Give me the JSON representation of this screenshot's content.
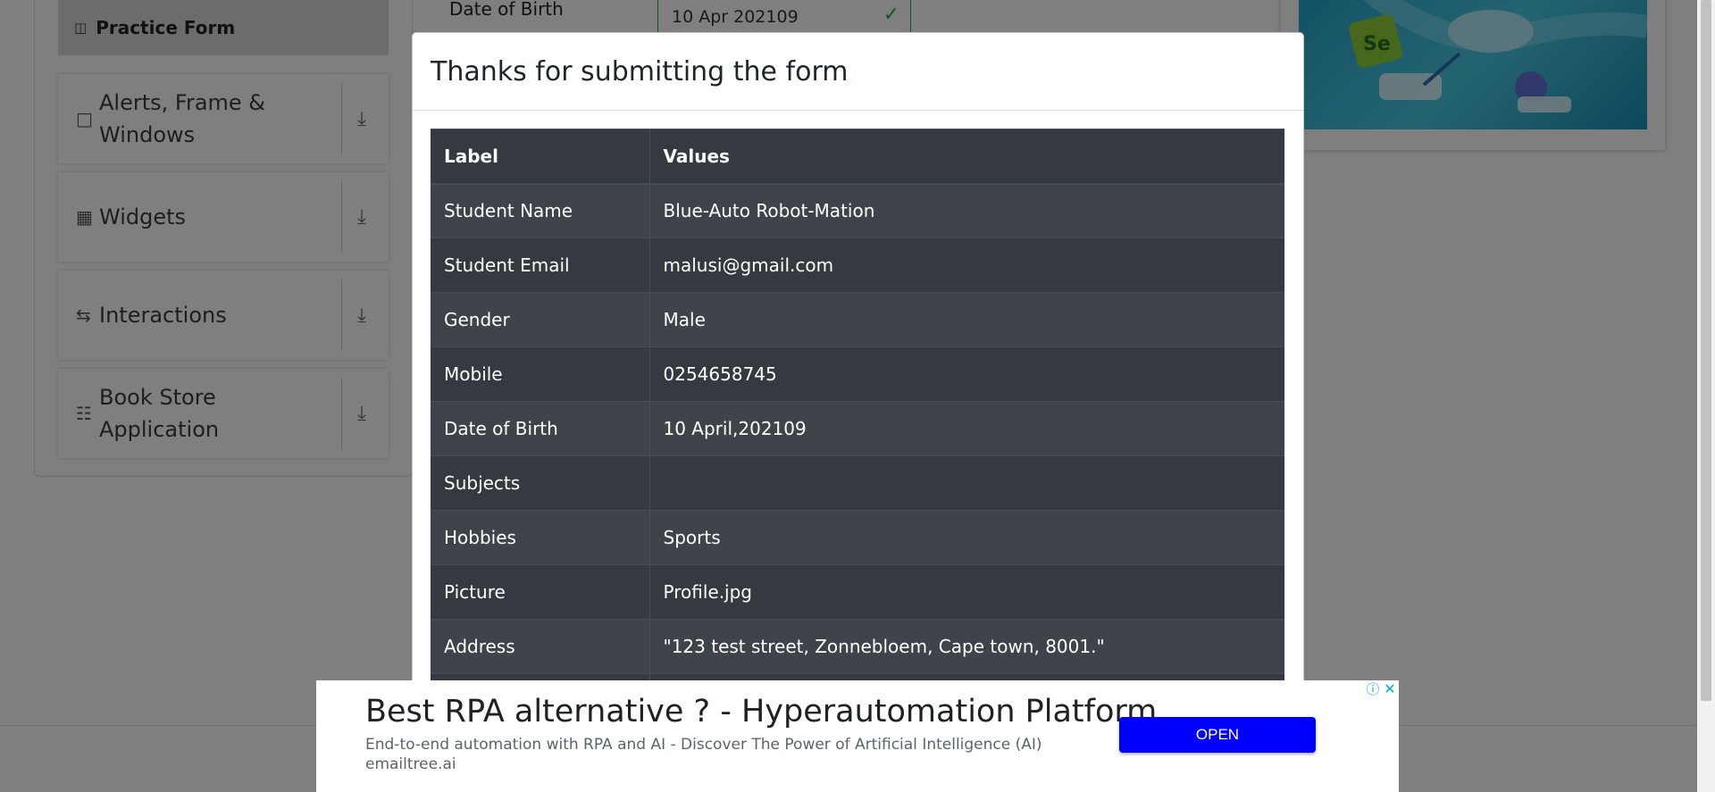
{
  "sidebar": {
    "practice_form": "Practice Form",
    "groups": [
      {
        "label": "Alerts, Frame & Windows",
        "icon": "window-icon"
      },
      {
        "label": "Widgets",
        "icon": "widgets-icon"
      },
      {
        "label": "Interactions",
        "icon": "interactions-icon"
      },
      {
        "label": "Book Store Application",
        "icon": "book-icon"
      }
    ]
  },
  "background_form": {
    "dob_label": "Date of Birth",
    "dob_value": "10 Apr 202109"
  },
  "modal": {
    "title": "Thanks for submitting the form",
    "headers": {
      "label": "Label",
      "values": "Values"
    },
    "rows": [
      {
        "label": "Student Name",
        "value": "Blue-Auto Robot-Mation"
      },
      {
        "label": "Student Email",
        "value": "malusi@gmail.com"
      },
      {
        "label": "Gender",
        "value": "Male"
      },
      {
        "label": "Mobile",
        "value": "0254658745"
      },
      {
        "label": "Date of Birth",
        "value": "10 April,202109"
      },
      {
        "label": "Subjects",
        "value": ""
      },
      {
        "label": "Hobbies",
        "value": "Sports"
      },
      {
        "label": "Picture",
        "value": "Profile.jpg"
      },
      {
        "label": "Address",
        "value": "\"123 test street, Zonnebloem, Cape town, 8001.\""
      }
    ]
  },
  "ad": {
    "headline": "Best RPA alternative ? - Hyperautomation Platform",
    "description": "End-to-end automation with RPA and AI - Discover The Power of Artificial Intelligence (AI)",
    "domain": "emailtree.ai",
    "cta": "OPEN"
  },
  "colors": {
    "overlay": "#000000",
    "table_dark": "#343a40",
    "ad_button": "#0000ff",
    "valid_green": "#28a745"
  }
}
